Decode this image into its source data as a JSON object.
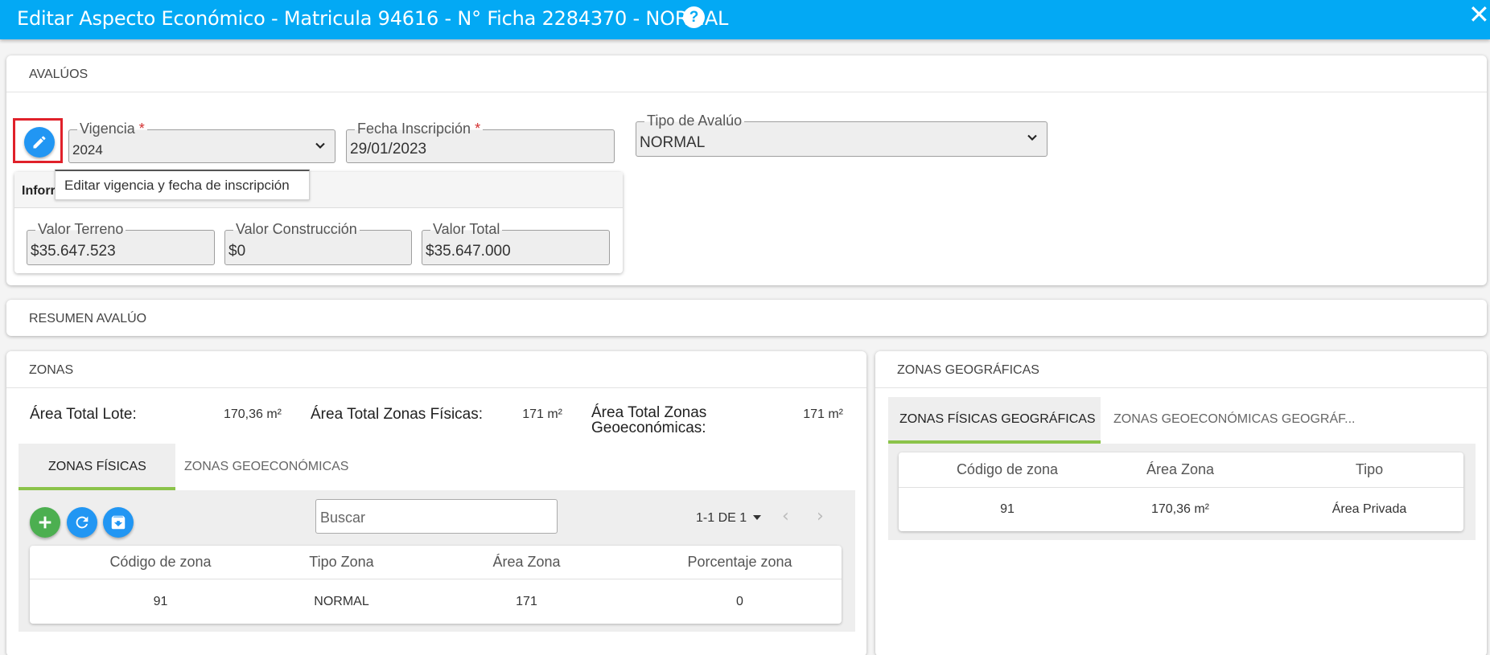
{
  "window": {
    "title": "Editar Aspecto Económico - Matricula 94616 - N° Ficha 2284370 - NORMAL",
    "help_label": "?",
    "close_label": "✕"
  },
  "avaluos": {
    "header": "AVALÚOS",
    "vigencia_label": "Vigencia",
    "vigencia_value": "2024",
    "fecha_label": "Fecha Inscripción",
    "fecha_value": "29/01/2023",
    "required_mark": "*",
    "tipo_label": "Tipo de Avalúo",
    "tipo_value": "NORMAL",
    "tooltip": "Editar vigencia y fecha de inscripción",
    "info_title": "Inforr",
    "valor_terreno_label": "Valor Terreno",
    "valor_terreno_value": "$35.647.523",
    "valor_construccion_label": "Valor Construcción",
    "valor_construccion_value": "$0",
    "valor_total_label": "Valor Total",
    "valor_total_value": "$35.647.000"
  },
  "resumen": {
    "header": "RESUMEN AVALÚO"
  },
  "zonas": {
    "header": "ZONAS",
    "area_lote_label": "Área Total Lote:",
    "area_lote_value": "170,36 m²",
    "area_fisicas_label": "Área Total Zonas Físicas:",
    "area_fisicas_value": "171 m²",
    "area_geo_label_1": "Área Total Zonas",
    "area_geo_label_2": "Geoeconómicas:",
    "area_geo_value": "171 m²",
    "tabs": [
      "ZONAS FÍSICAS",
      "ZONAS GEOECONÓMICAS"
    ],
    "search_placeholder": "Buscar",
    "pager": "1-1 DE 1",
    "columns": [
      "Código de zona",
      "Tipo Zona",
      "Área Zona",
      "Porcentaje zona"
    ],
    "rows": [
      [
        "91",
        "NORMAL",
        "171",
        "0"
      ]
    ]
  },
  "geograficas": {
    "header": "ZONAS GEOGRÁFICAS",
    "tabs": [
      "ZONAS FÍSICAS GEOGRÁFICAS",
      "ZONAS GEOECONÓMICAS GEOGRÁF..."
    ],
    "columns": [
      "Código de zona",
      "Área Zona",
      "Tipo"
    ],
    "rows": [
      [
        "91",
        "170,36 m²",
        "Área Privada"
      ]
    ]
  },
  "colors": {
    "titlebar": "#03a9f4",
    "accent_blue": "#2196f3",
    "add_green": "#4caf50",
    "tab_underline": "#8bc34a",
    "highlight_red": "#e0212a"
  }
}
